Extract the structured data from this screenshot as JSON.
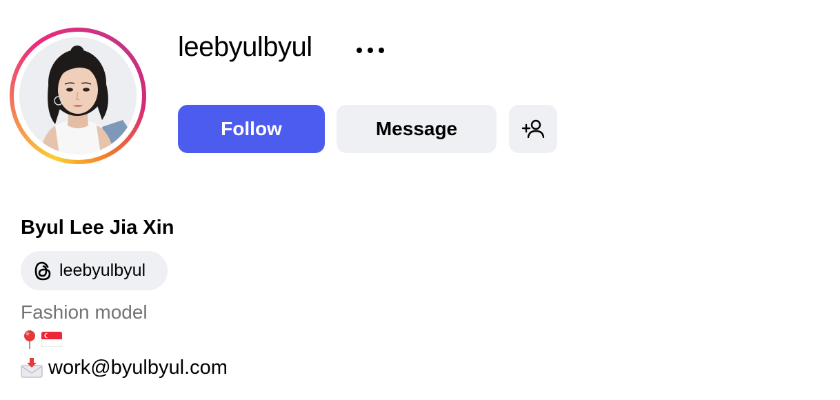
{
  "profile": {
    "username": "leebyulbyul",
    "full_name": "Byul Lee Jia Xin",
    "threads_handle": "leebyulbyul",
    "category": "Fashion model",
    "email": "work@byulbyul.com"
  },
  "actions": {
    "follow_label": "Follow",
    "message_label": "Message"
  },
  "icons": {
    "more": "more-horizontal-icon",
    "add_person": "add-person-icon",
    "threads": "threads-icon",
    "location": "round-pushpin-icon",
    "flag": "singapore-flag-icon",
    "envelope": "envelope-with-arrow-icon"
  },
  "colors": {
    "follow_button": "#4c5cef",
    "secondary_button": "#eff0f4",
    "muted_text": "#737373"
  }
}
